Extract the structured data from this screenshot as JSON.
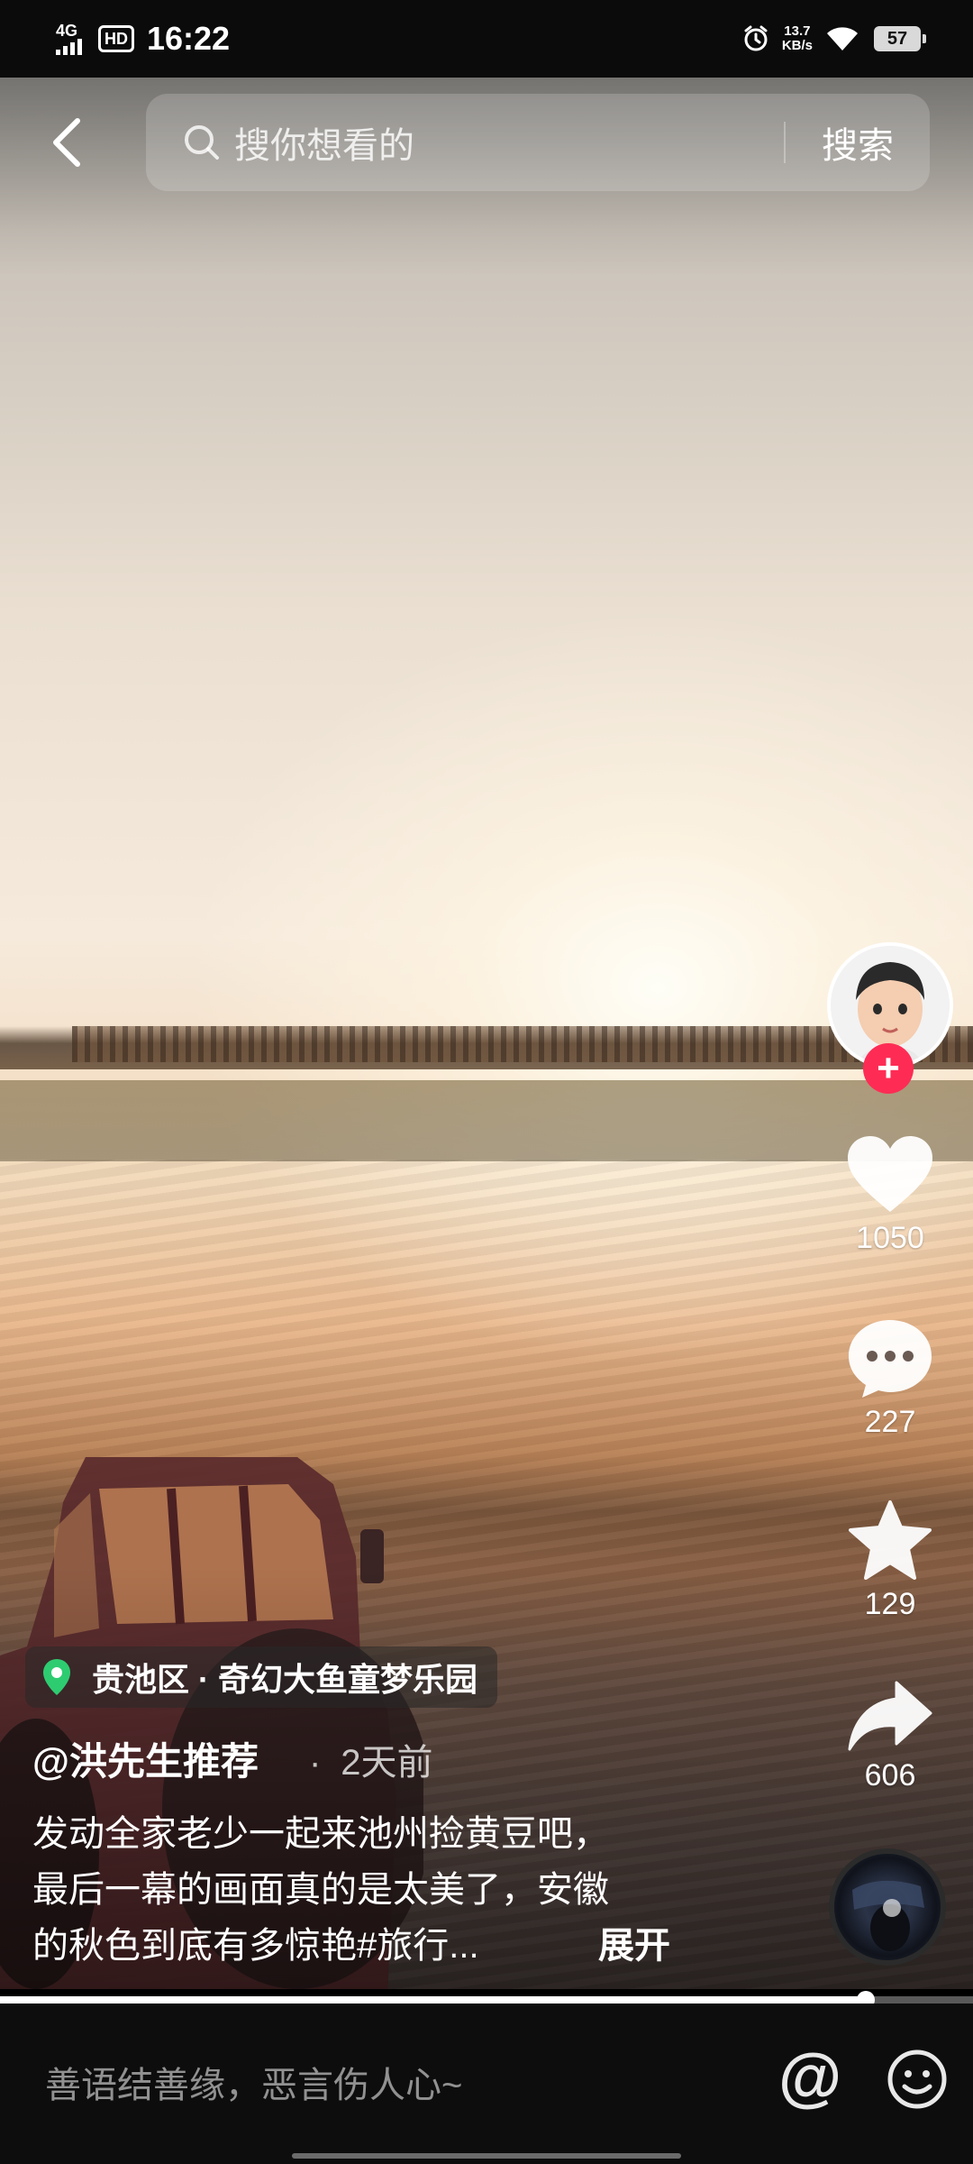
{
  "status_bar": {
    "network": "4G",
    "hd": "HD",
    "time": "16:22",
    "net_speed_value": "13.7",
    "net_speed_unit": "KB/s",
    "battery": "57"
  },
  "search": {
    "placeholder": "搜你想看的",
    "button_label": "搜索"
  },
  "actions": {
    "likes": "1050",
    "comments": "227",
    "favorites": "129",
    "shares": "606",
    "follow_symbol": "+"
  },
  "post": {
    "location": "贵池区 · 奇幻大鱼童梦乐园",
    "author": "@洪先生推荐",
    "time": "2天前",
    "caption_lines": [
      "发动全家老少一起来池州捡黄豆吧，",
      "最后一幕的画面真的是太美了，安徽",
      "的秋色到底有多惊艳#旅行..."
    ],
    "expand_label": "展开"
  },
  "playback": {
    "progress": 0.89
  },
  "comment_bar": {
    "placeholder": "善语结善缘，恶言伤人心~",
    "mention_label": "@"
  },
  "colors": {
    "accent": "#fe2c55",
    "location_pin": "#2ecc71"
  }
}
